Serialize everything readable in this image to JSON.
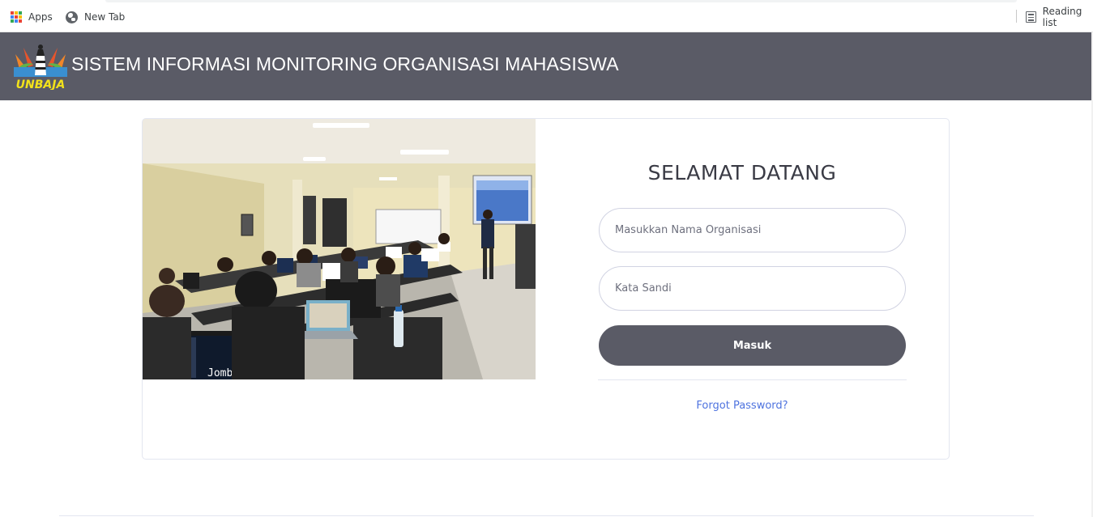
{
  "bookmarks": {
    "apps_label": "Apps",
    "newtab_label": "New Tab",
    "reading_label": "Reading list"
  },
  "header": {
    "logo_text": "UNBAJA",
    "title": "SISTEM INFORMASI MONITORING ORGANISASI MAHASISWA"
  },
  "login": {
    "welcome": "SELAMAT DATANG",
    "org_placeholder": "Masukkan Nama Organisasi",
    "password_placeholder": "Kata Sandi",
    "submit_label": "Masuk",
    "forgot_label": "Forgot Password?"
  },
  "photo": {
    "screen_text": "Jomblo"
  },
  "colors": {
    "header_bg": "#5a5b66",
    "button_bg": "#5a5b66",
    "link": "#4e73df",
    "logo_yellow": "#f2e21b"
  }
}
